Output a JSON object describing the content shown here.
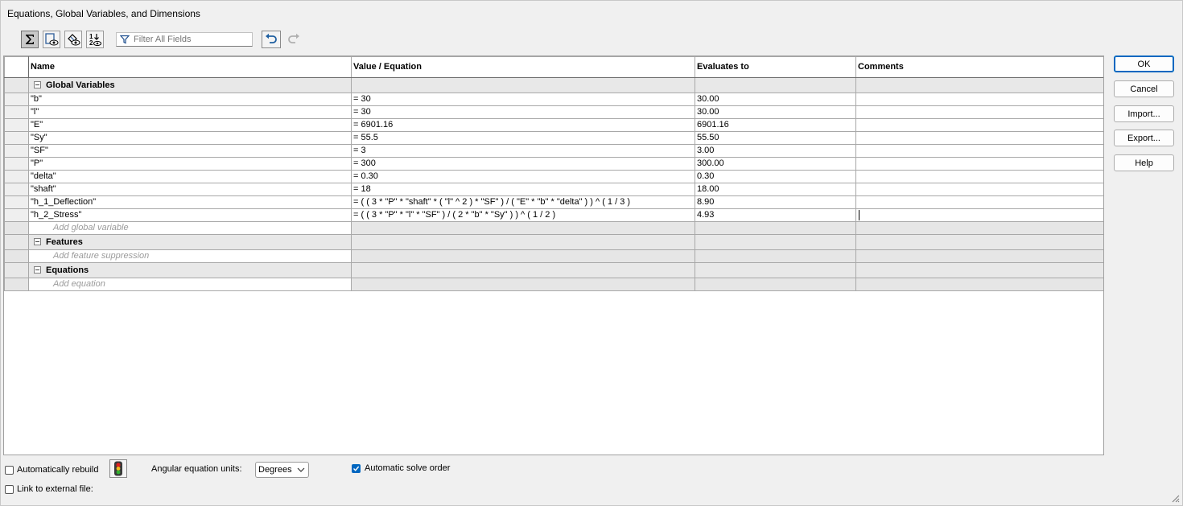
{
  "window": {
    "title": "Equations, Global Variables, and Dimensions"
  },
  "toolbar": {
    "buttons": [
      {
        "icon": "equation-view-icon",
        "active": true
      },
      {
        "icon": "sketch-equation-view-icon",
        "active": false
      },
      {
        "icon": "dimension-view-icon",
        "active": false
      },
      {
        "icon": "ordered-view-icon",
        "active": false
      }
    ],
    "filter_placeholder": "Filter All Fields",
    "undo_icon": "undo-icon",
    "redo_icon": "redo-icon"
  },
  "columns": {
    "name": "Name",
    "value": "Value / Equation",
    "evaluates": "Evaluates to",
    "comments": "Comments"
  },
  "sections": {
    "global": {
      "label": "Global Variables",
      "add_placeholder": "Add global variable"
    },
    "features": {
      "label": "Features",
      "add_placeholder": "Add feature suppression"
    },
    "equations": {
      "label": "Equations",
      "add_placeholder": "Add equation"
    }
  },
  "rows": [
    {
      "name": "\"b\"",
      "value": "= 30",
      "evaluates": "30.00",
      "comment": ""
    },
    {
      "name": "\"l\"",
      "value": "= 30",
      "evaluates": "30.00",
      "comment": ""
    },
    {
      "name": "\"E\"",
      "value": "= 6901.16",
      "evaluates": "6901.16",
      "comment": ""
    },
    {
      "name": "\"Sy\"",
      "value": "= 55.5",
      "evaluates": "55.50",
      "comment": ""
    },
    {
      "name": "\"SF\"",
      "value": "= 3",
      "evaluates": "3.00",
      "comment": ""
    },
    {
      "name": "\"P\"",
      "value": "= 300",
      "evaluates": "300.00",
      "comment": ""
    },
    {
      "name": "\"delta\"",
      "value": "= 0.30",
      "evaluates": "0.30",
      "comment": ""
    },
    {
      "name": "\"shaft\"",
      "value": "= 18",
      "evaluates": "18.00",
      "comment": ""
    },
    {
      "name": "\"h_1_Deflection\"",
      "value": "= ( ( 3 * \"P\" * \"shaft\" * ( \"l\" ^ 2 ) * \"SF\" ) / ( \"E\" * \"b\" * \"delta\" ) ) ^ ( 1 / 3 )",
      "evaluates": "8.90",
      "comment": ""
    },
    {
      "name": "\"h_2_Stress\"",
      "value": "= ( ( 3 * \"P\" * \"l\" * \"SF\" ) / ( 2 * \"b\" * \"Sy\" ) ) ^ ( 1 / 2 )",
      "evaluates": "4.93",
      "comment": ""
    }
  ],
  "buttons": {
    "ok": "OK",
    "cancel": "Cancel",
    "import": "Import...",
    "export": "Export...",
    "help": "Help"
  },
  "bottom": {
    "auto_rebuild_label": "Automatically rebuild",
    "auto_rebuild_checked": false,
    "rebuild_icon": "traffic-light-icon",
    "angular_units_label": "Angular equation units:",
    "angular_units_value": "Degrees",
    "auto_solve_label": "Automatic solve order",
    "auto_solve_checked": true,
    "link_label": "Link to external file:",
    "link_checked": false
  }
}
